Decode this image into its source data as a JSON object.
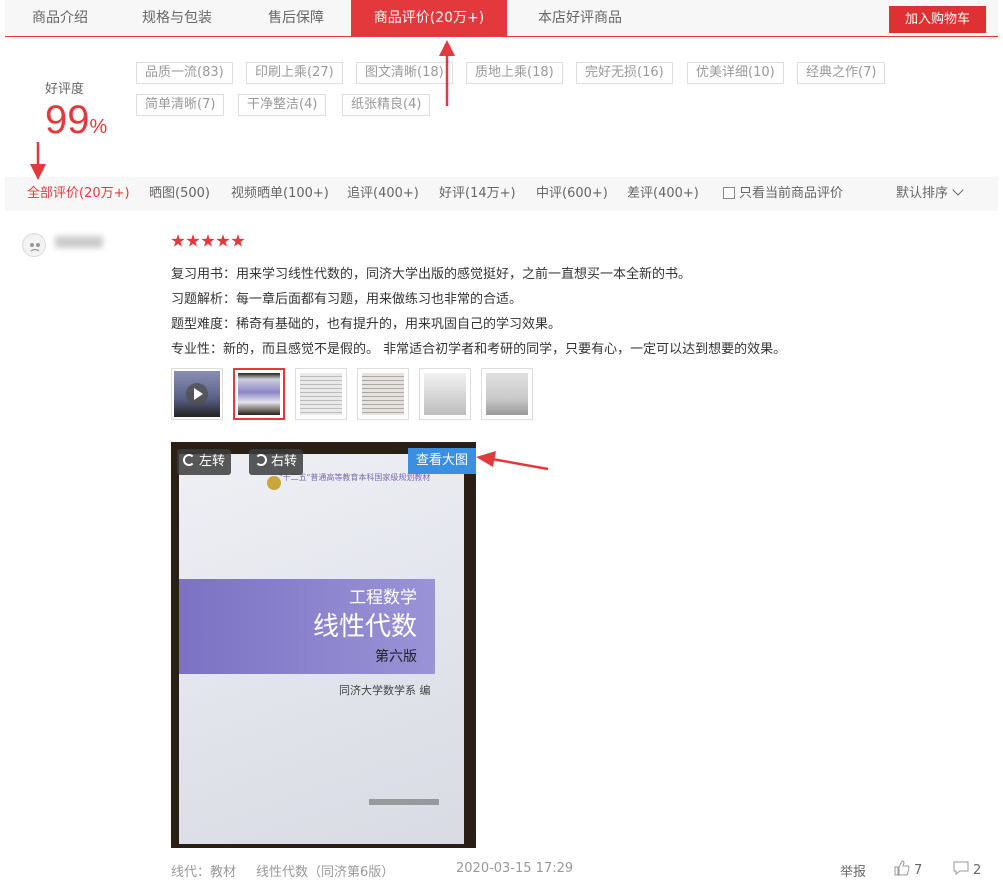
{
  "tabs": [
    {
      "label": "商品介绍"
    },
    {
      "label": "规格与包装"
    },
    {
      "label": "售后保障"
    },
    {
      "label": "商品评价(20万+)"
    },
    {
      "label": "本店好评商品"
    }
  ],
  "cart_button": "加入购物车",
  "rating": {
    "label": "好评度",
    "value": "99",
    "unit": "%"
  },
  "tags": [
    "品质一流(83)",
    "印刷上乘(27)",
    "图文清晰(18)",
    "质地上乘(18)",
    "完好无损(16)",
    "优美详细(10)",
    "经典之作(7)",
    "简单清晰(7)",
    "干净整洁(4)",
    "纸张精良(4)"
  ],
  "filters": [
    "全部评价(20万+)",
    "晒图(500)",
    "视频晒单(100+)",
    "追评(400+)",
    "好评(14万+)",
    "中评(600+)",
    "差评(400+)"
  ],
  "only_current_label": "只看当前商品评价",
  "sort_label": "默认排序",
  "review": {
    "stars": 5,
    "lines": [
      "复习用书：用来学习线性代数的，同济大学出版的感觉挺好，之前一直想买一本全新的书。",
      "习题解析：每一章后面都有习题，用来做练习也非常的合适。",
      "题型难度：稀奇有基础的，也有提升的，用来巩固自己的学习效果。",
      "专业性：新的，而且感觉不是假的。 非常适合初学者和考研的同学，只要有心，一定可以达到想要的效果。"
    ],
    "rotate_left": "左转",
    "rotate_right": "右转",
    "view_large": "查看大图",
    "book": {
      "series": "\"十二五\"普通高等教育本科国家级规划教材",
      "title_top": "工程数学",
      "title_main": "线性代数",
      "edition": "第六版",
      "author": "同济大学数学系 编"
    },
    "meta_type": "线代：教材",
    "meta_product": "线性代数（同济第6版）",
    "date": "2020-03-15 17:29",
    "report": "举报",
    "likes": "7",
    "replies": "2"
  }
}
